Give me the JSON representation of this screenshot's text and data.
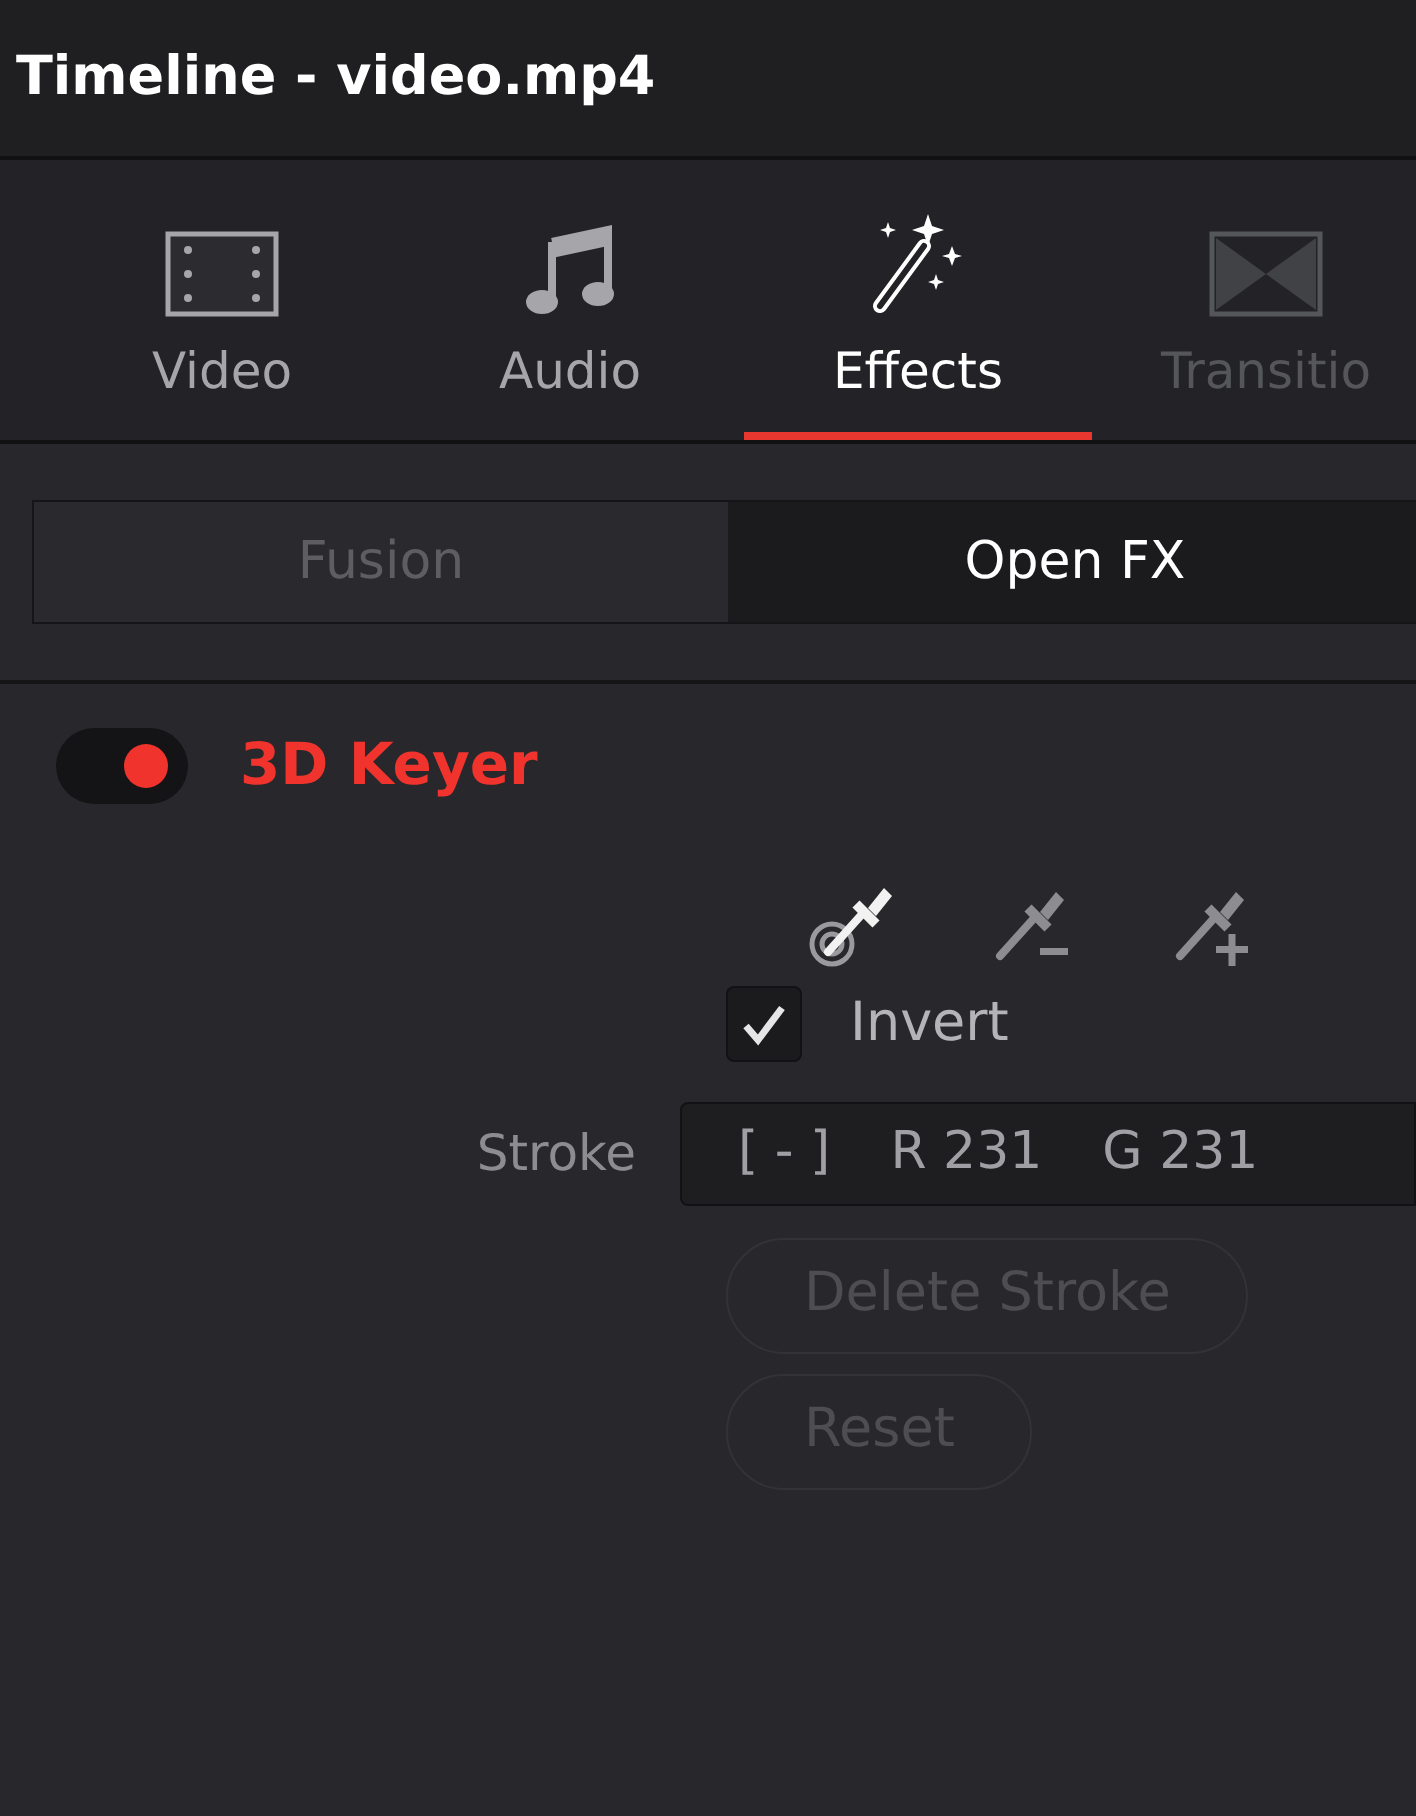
{
  "window": {
    "title": "Timeline - video.mp4"
  },
  "tabs": [
    {
      "label": "Video",
      "kind": "film",
      "selected": false,
      "disabled": false
    },
    {
      "label": "Audio",
      "kind": "music",
      "selected": false,
      "disabled": false
    },
    {
      "label": "Effects",
      "kind": "wand",
      "selected": true,
      "disabled": false
    },
    {
      "label": "Transitio",
      "kind": "transition",
      "selected": false,
      "disabled": true
    }
  ],
  "subtabs": [
    {
      "label": "Fusion",
      "selected": false
    },
    {
      "label": "Open FX",
      "selected": true
    }
  ],
  "effect": {
    "name": "3D Keyer",
    "on": true
  },
  "tools": [
    {
      "kind": "pick",
      "selected": true
    },
    {
      "kind": "subtract",
      "selected": false
    },
    {
      "kind": "add",
      "selected": false
    }
  ],
  "invert": {
    "label": "Invert",
    "checked": true
  },
  "stroke": {
    "label": "Stroke",
    "values": [
      "[ - ]",
      "R 231",
      "G 231"
    ]
  },
  "buttons": [
    {
      "label": "Delete Stroke",
      "disabled": true
    },
    {
      "label": "Reset",
      "disabled": true
    }
  ]
}
